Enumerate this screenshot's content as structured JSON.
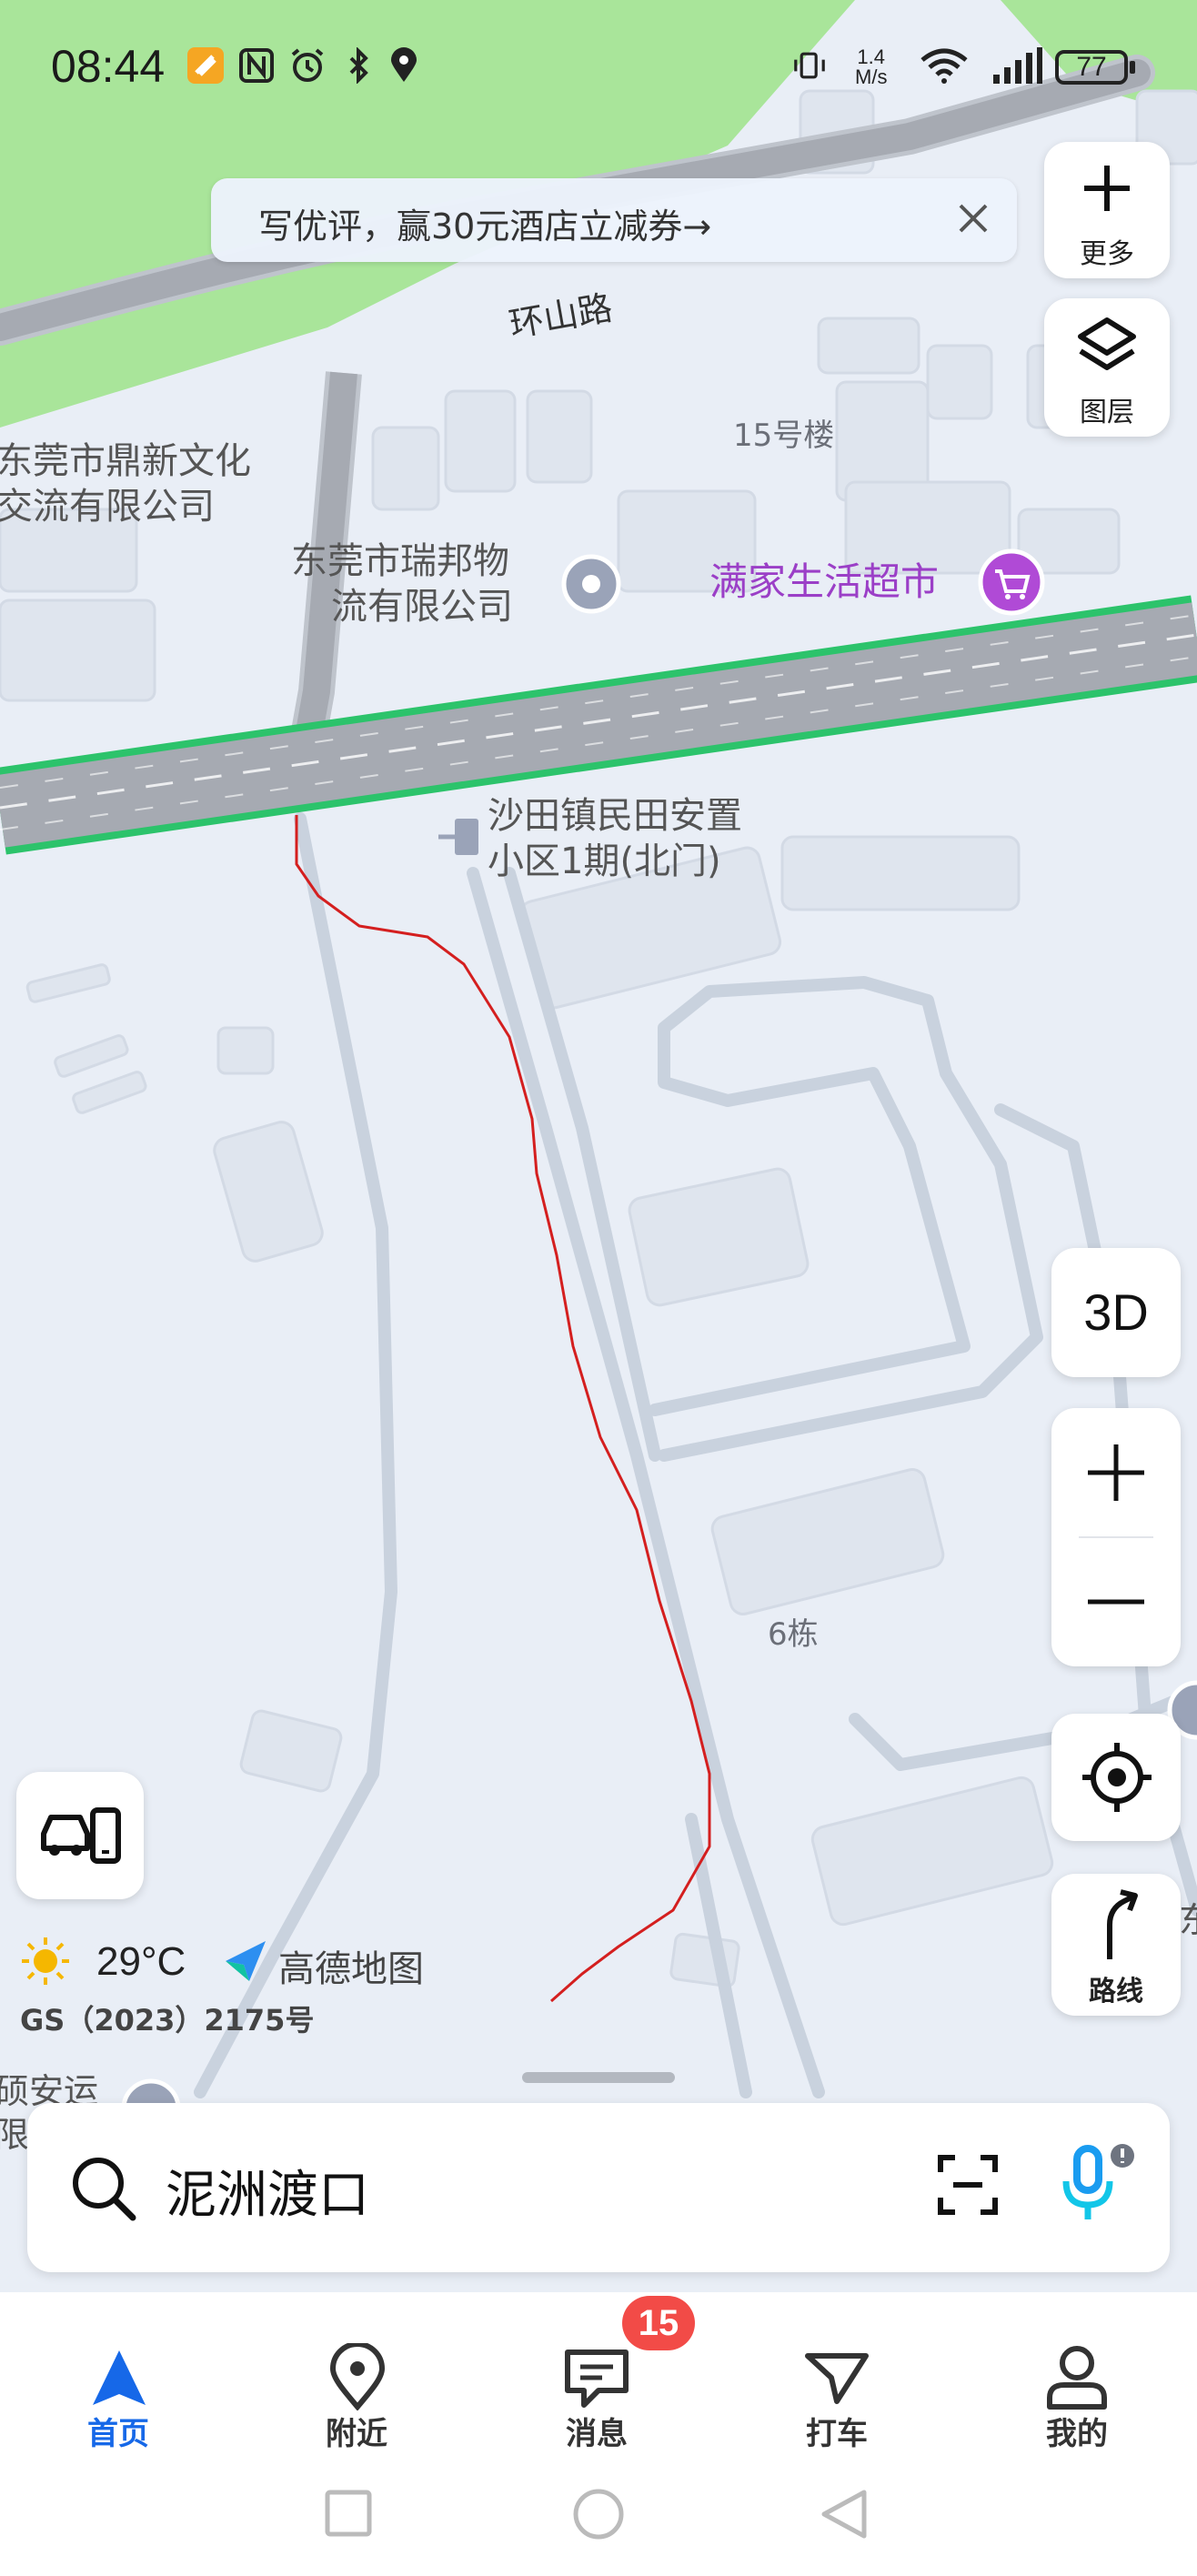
{
  "status_bar": {
    "time": "08:44",
    "net_speed_value": "1.4",
    "net_speed_unit": "M/s",
    "battery": "77"
  },
  "banner": {
    "text": "写优评，赢30元酒店立减券→"
  },
  "side_controls": {
    "more_label": "更多",
    "layers_label": "图层",
    "mode_3d_label": "3D",
    "zoom_in_symbol": "+",
    "zoom_out_symbol": "—",
    "route_label": "路线"
  },
  "map": {
    "road_label": "环山路",
    "pois": {
      "dingxin": "东莞市鼎新文化交流有限公司",
      "dingxin_line1": "东莞市鼎新文化",
      "dingxin_line2": "交流有限公司",
      "ruibang_line1": "东莞市瑞邦物",
      "ruibang_line2": "流有限公司",
      "manjia": "满家生活超市",
      "building15": "15号楼",
      "shatian_line1": "沙田镇民田安置",
      "shatian_line2": "小区1期(北门)",
      "building6": "6栋",
      "edge_left_line1": "硕安运",
      "edge_left_line2": "限公",
      "edge_right": "东"
    },
    "colors": {
      "green_area": "#a9e59a",
      "road_fill": "#a6aab2",
      "road_edge_green": "#2cc36b",
      "route_red": "#d41f1f",
      "poi_purple": "#9b3fc7",
      "background": "#e9eef6"
    }
  },
  "weather": {
    "icon": "sun-icon",
    "temperature": "29°C"
  },
  "brand": {
    "name": "高德地图",
    "license": "GS（2023）2175号"
  },
  "search": {
    "value": "泥洲渡口"
  },
  "bottom_nav": {
    "items": [
      {
        "label": "首页",
        "icon": "navigation-arrow-icon",
        "active": true
      },
      {
        "label": "附近",
        "icon": "location-pin-icon",
        "active": false
      },
      {
        "label": "消息",
        "icon": "message-icon",
        "active": false
      },
      {
        "label": "打车",
        "icon": "taxi-icon",
        "active": false
      },
      {
        "label": "我的",
        "icon": "profile-icon",
        "active": false
      }
    ],
    "messages_badge": "15"
  }
}
